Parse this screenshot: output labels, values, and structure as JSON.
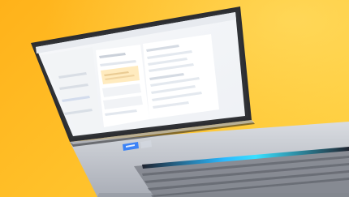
{
  "scene": {
    "background_colors": [
      "#ffb21a",
      "#ffcf3d"
    ],
    "subject": "laptop-with-form-ui",
    "laptop": {
      "body_color": "#c9ccd2",
      "bezel_color": "#2c2d31",
      "keyboard_color": "#7f838b",
      "touchbar_accent": "#3ad1ff"
    }
  },
  "screen_ui": {
    "form_title": "",
    "primary_button_color": "#3b82f6",
    "highlight_field_color": "#ffe7b0"
  }
}
